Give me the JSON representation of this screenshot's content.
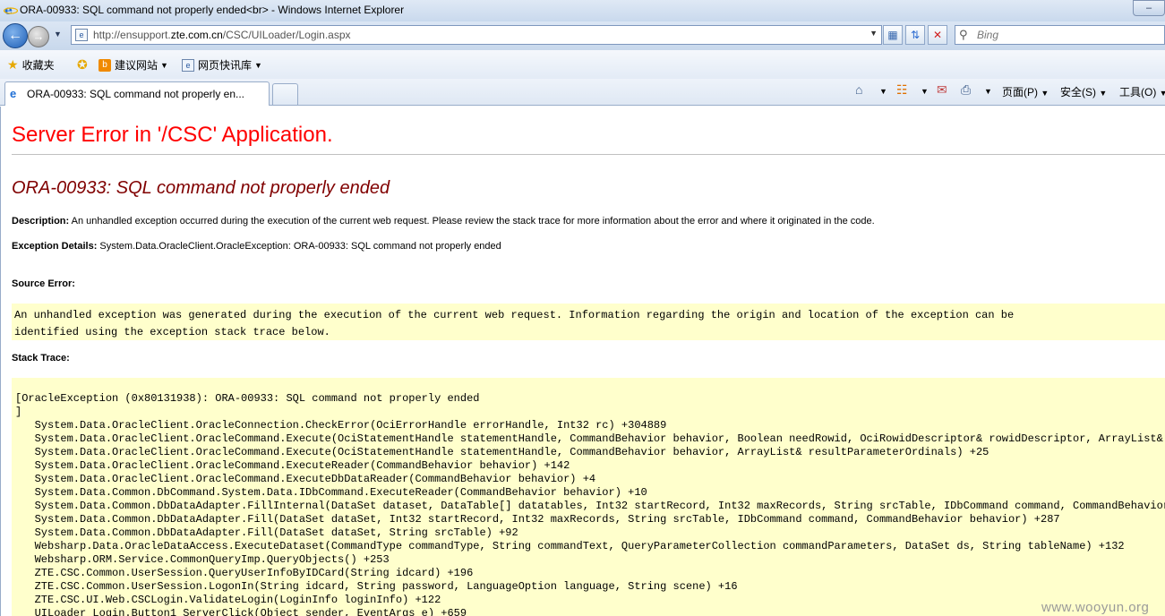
{
  "window": {
    "title": "ORA-00933: SQL command not properly ended<br> - Windows Internet Explorer"
  },
  "address": {
    "url_prefix": "http://ensupport.",
    "url_domain": "zte.com.cn",
    "url_suffix": "/CSC/UILoader/Login.aspx",
    "search_placeholder": "Bing"
  },
  "favorites": {
    "favorites_label": "收藏夹",
    "suggested_sites": "建议网站",
    "web_slice_gallery": "网页快讯库"
  },
  "tab": {
    "label": "ORA-00933: SQL command not properly en..."
  },
  "commands": {
    "page": "页面(P)",
    "safety": "安全(S)",
    "tools": "工具(O)"
  },
  "page": {
    "heading": "Server Error in '/CSC' Application.",
    "error_message": "ORA-00933: SQL command not properly ended",
    "description_label": "Description:",
    "description_text": " An unhandled exception occurred during the execution of the current web request. Please review the stack trace for more information about the error and where it originated in the code.",
    "exception_label": "Exception Details:",
    "exception_text": " System.Data.OracleClient.OracleException: ORA-00933: SQL command not properly ended",
    "source_error_label": "Source Error:",
    "source_error_line1": "An unhandled exception was generated during the execution of the current web request. Information regarding the origin and location of the exception can be",
    "source_error_line2": "identified using the exception stack trace below.",
    "stack_trace_label": "Stack Trace:",
    "stack_trace": [
      "[OracleException (0x80131938): ORA-00933: SQL command not properly ended",
      "]",
      "   System.Data.OracleClient.OracleConnection.CheckError(OciErrorHandle errorHandle, Int32 rc) +304889",
      "   System.Data.OracleClient.OracleCommand.Execute(OciStatementHandle statementHandle, CommandBehavior behavior, Boolean needRowid, OciRowidDescriptor& rowidDescriptor, ArrayList& resul",
      "   System.Data.OracleClient.OracleCommand.Execute(OciStatementHandle statementHandle, CommandBehavior behavior, ArrayList& resultParameterOrdinals) +25",
      "   System.Data.OracleClient.OracleCommand.ExecuteReader(CommandBehavior behavior) +142",
      "   System.Data.OracleClient.OracleCommand.ExecuteDbDataReader(CommandBehavior behavior) +4",
      "   System.Data.Common.DbCommand.System.Data.IDbCommand.ExecuteReader(CommandBehavior behavior) +10",
      "   System.Data.Common.DbDataAdapter.FillInternal(DataSet dataset, DataTable[] datatables, Int32 startRecord, Int32 maxRecords, String srcTable, IDbCommand command, CommandBehavior beha",
      "   System.Data.Common.DbDataAdapter.Fill(DataSet dataSet, Int32 startRecord, Int32 maxRecords, String srcTable, IDbCommand command, CommandBehavior behavior) +287",
      "   System.Data.Common.DbDataAdapter.Fill(DataSet dataSet, String srcTable) +92",
      "   Websharp.Data.OracleDataAccess.ExecuteDataset(CommandType commandType, String commandText, QueryParameterCollection commandParameters, DataSet ds, String tableName) +132",
      "   Websharp.ORM.Service.CommonQueryImp.QueryObjects() +253",
      "   ZTE.CSC.Common.UserSession.QueryUserInfoByIDCard(String idcard) +196",
      "   ZTE.CSC.Common.UserSession.LogonIn(String idcard, String password, LanguageOption language, String scene) +16",
      "   ZTE.CSC.UI.Web.CSCLogin.ValidateLogin(LoginInfo loginInfo) +122",
      "   UILoader_Login.Button1_ServerClick(Object sender, EventArgs e) +659"
    ]
  },
  "watermark": "www.wooyun.org"
}
